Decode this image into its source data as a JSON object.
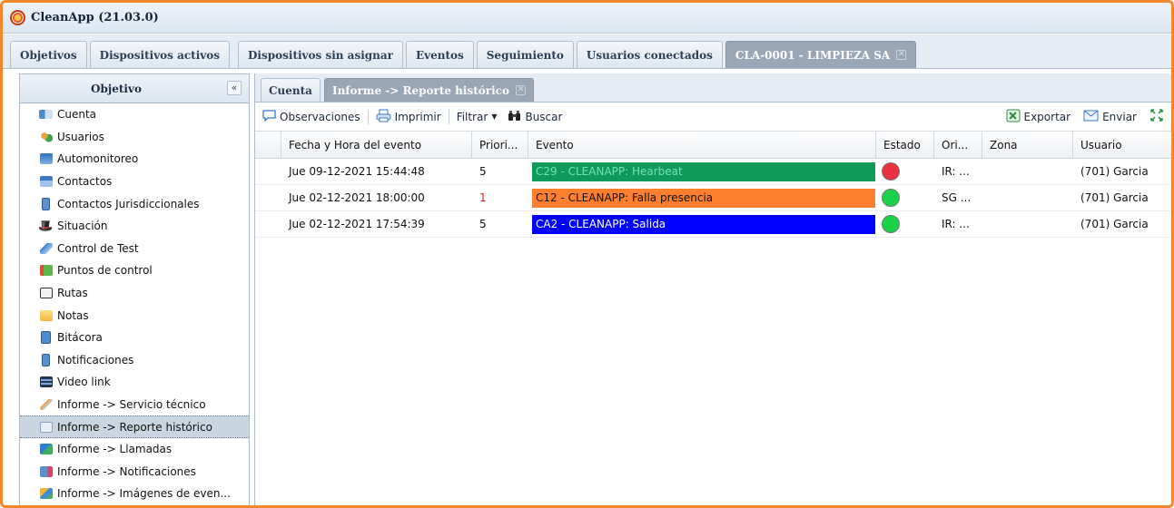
{
  "app": {
    "title": "CleanApp (21.03.0)"
  },
  "top_tabs": [
    {
      "label": "Objetivos"
    },
    {
      "label": "Dispositivos activos"
    },
    {
      "label": "Dispositivos sin asignar"
    },
    {
      "label": "Eventos"
    },
    {
      "label": "Seguimiento"
    },
    {
      "label": "Usuarios conectados"
    },
    {
      "label": "CLA-0001 - LIMPIEZA SA",
      "active": true,
      "close": "✕"
    }
  ],
  "sidebar": {
    "title": "Objetivo",
    "collapse": "«",
    "items": [
      {
        "label": "Cuenta",
        "icon": "account-card-icon"
      },
      {
        "label": "Usuarios",
        "icon": "users-icon"
      },
      {
        "label": "Automonitoreo",
        "icon": "self-monitoring-icon"
      },
      {
        "label": "Contactos",
        "icon": "contacts-icon"
      },
      {
        "label": "Contactos Jurisdiccionales",
        "icon": "jurisdictional-contacts-icon"
      },
      {
        "label": "Situación",
        "icon": "binoculars-icon"
      },
      {
        "label": "Control de Test",
        "icon": "test-control-icon"
      },
      {
        "label": "Puntos de control",
        "icon": "checkpoints-icon"
      },
      {
        "label": "Rutas",
        "icon": "routes-map-icon"
      },
      {
        "label": "Notas",
        "icon": "notes-icon"
      },
      {
        "label": "Bitácora",
        "icon": "logbook-icon"
      },
      {
        "label": "Notificaciones",
        "icon": "notifications-icon"
      },
      {
        "label": "Video link",
        "icon": "video-film-icon"
      },
      {
        "label": "Informe -> Servicio técnico",
        "icon": "wrench-icon"
      },
      {
        "label": "Informe -> Reporte histórico",
        "icon": "history-report-icon",
        "active": true
      },
      {
        "label": "Informe -> Llamadas",
        "icon": "calls-report-icon"
      },
      {
        "label": "Informe -> Notificaciones",
        "icon": "notifications-report-icon"
      },
      {
        "label": "Informe -> Imágenes de even...",
        "icon": "event-images-icon"
      }
    ]
  },
  "sub_tabs": [
    {
      "label": "Cuenta"
    },
    {
      "label": "Informe -> Reporte histórico",
      "active": true,
      "close": "✕"
    }
  ],
  "toolbar": {
    "observaciones": "Observaciones",
    "imprimir": "Imprimir",
    "filtrar": "Filtrar",
    "buscar": "Buscar",
    "exportar": "Exportar",
    "enviar": "Enviar"
  },
  "grid": {
    "columns": [
      "Fecha y Hora del evento",
      "Priori...",
      "Evento",
      "Estado",
      "Ori...",
      "Zona",
      "Usuario"
    ],
    "rows": [
      {
        "fecha": "Jue 09-12-2021 15:44:48",
        "prioridad": "5",
        "evento": "C29 - CLEANAPP: Hearbeat",
        "evento_bg": "#0f9a5a",
        "evento_fg": "#74e0b8",
        "estado": "red",
        "origen": "IR: ...",
        "zona": "",
        "usuario": "(701) Garcia"
      },
      {
        "fecha": "Jue 02-12-2021 18:00:00",
        "prioridad": "1",
        "prioridad_color": "#e52222",
        "evento": "C12 - CLEANAPP: Falla presencia",
        "evento_bg": "#fe7f2e",
        "evento_fg": "#111111",
        "estado": "green",
        "origen": "SG ...",
        "zona": "",
        "usuario": "(701) Garcia"
      },
      {
        "fecha": "Jue 02-12-2021 17:54:39",
        "prioridad": "5",
        "evento": "CA2 - CLEANAPP: Salida",
        "evento_bg": "#0000ff",
        "evento_fg": "#ffffff",
        "estado": "green",
        "origen": "IR: ...",
        "zona": "",
        "usuario": "(701) Garcia"
      }
    ]
  },
  "colors": {
    "frame": "#f4862c",
    "status_red": "#e8303f",
    "status_green": "#19d24a"
  }
}
